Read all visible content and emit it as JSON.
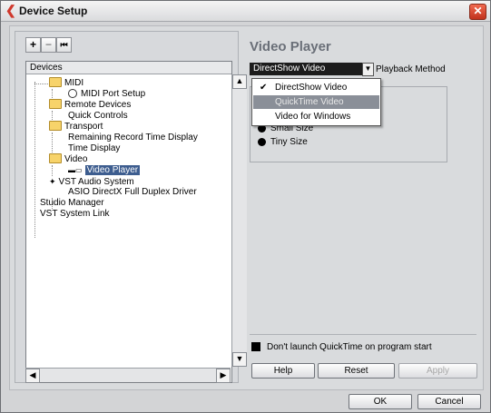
{
  "window": {
    "title": "Device Setup",
    "close_label": "✕"
  },
  "toolbar": {
    "add_label": "+",
    "remove_label": "−",
    "reset_label": "⏮"
  },
  "tree": {
    "header": "Devices",
    "items": [
      {
        "label": "MIDI"
      },
      {
        "label": "MIDI Port Setup"
      },
      {
        "label": "Remote Devices"
      },
      {
        "label": "Quick Controls"
      },
      {
        "label": "Transport"
      },
      {
        "label": "Remaining Record Time Display"
      },
      {
        "label": "Time Display"
      },
      {
        "label": "Video"
      },
      {
        "label": "Video Player"
      },
      {
        "label": "VST Audio System"
      },
      {
        "label": "ASIO DirectX Full Duplex Driver"
      },
      {
        "label": "Studio Manager"
      },
      {
        "label": "VST System Link"
      }
    ]
  },
  "panel": {
    "title": "Video Player",
    "playback_method_value": "DirectShow Video",
    "playback_method_label": "Playback Method",
    "menu": [
      {
        "label": "DirectShow Video",
        "checked": "✔"
      },
      {
        "label": "QuickTime Video"
      },
      {
        "label": "Video for Windows"
      }
    ],
    "sizes": [
      {
        "label": "Small Size"
      },
      {
        "label": "Tiny Size"
      }
    ],
    "checkbox_label": "Don't launch QuickTime on program start",
    "help_label": "Help",
    "reset_label": "Reset",
    "apply_label": "Apply"
  },
  "footer": {
    "ok_label": "OK",
    "cancel_label": "Cancel"
  }
}
